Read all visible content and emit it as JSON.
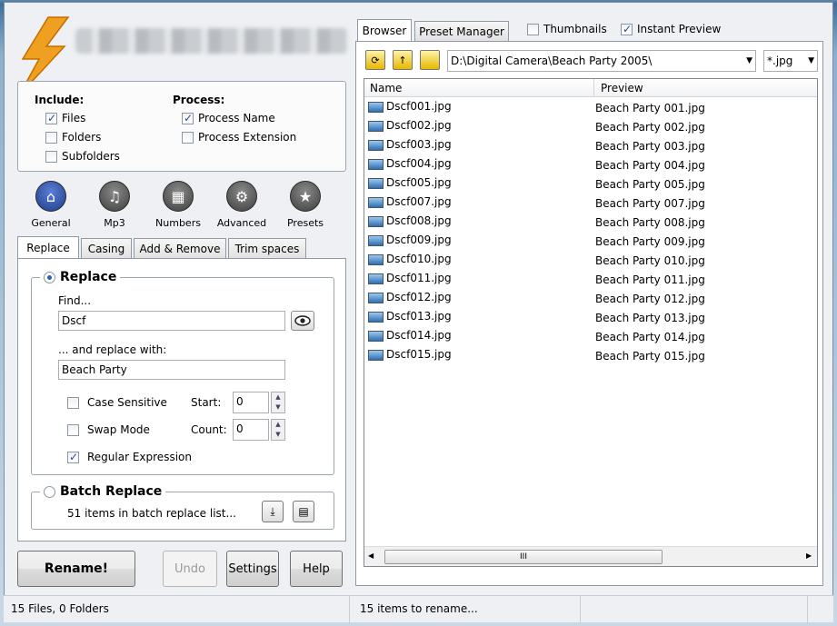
{
  "include": {
    "label": "Include:",
    "files": "Files",
    "folders": "Folders",
    "subfolders": "Subfolders"
  },
  "process": {
    "label": "Process:",
    "name": "Process Name",
    "extension": "Process Extension"
  },
  "modes": [
    {
      "label": "General"
    },
    {
      "label": "Mp3"
    },
    {
      "label": "Numbers"
    },
    {
      "label": "Advanced"
    },
    {
      "label": "Presets"
    }
  ],
  "subtabs": [
    "Replace",
    "Casing",
    "Add & Remove",
    "Trim spaces"
  ],
  "replace": {
    "title": "Replace",
    "find_label": "Find...",
    "find_value": "Dscf",
    "replace_label": "... and replace with:",
    "replace_value": "Beach Party",
    "case_sensitive": "Case Sensitive",
    "start_label": "Start:",
    "start_value": "0",
    "swap_mode": "Swap Mode",
    "count_label": "Count:",
    "count_value": "0",
    "regex": "Regular Expression"
  },
  "batch": {
    "title": "Batch Replace",
    "info": "51 items in batch replace list..."
  },
  "buttons": {
    "rename": "Rename!",
    "undo": "Undo",
    "settings": "Settings",
    "help": "Help"
  },
  "right_tabs": {
    "browser": "Browser",
    "preset_manager": "Preset Manager",
    "thumbnails": "Thumbnails",
    "instant_preview": "Instant Preview"
  },
  "path": "D:\\Digital Camera\\Beach Party 2005\\",
  "filter": "*.jpg",
  "columns": {
    "name": "Name",
    "preview": "Preview"
  },
  "files": [
    {
      "name": "Dscf001.jpg",
      "preview": "Beach Party 001.jpg"
    },
    {
      "name": "Dscf002.jpg",
      "preview": "Beach Party 002.jpg"
    },
    {
      "name": "Dscf003.jpg",
      "preview": "Beach Party 003.jpg"
    },
    {
      "name": "Dscf004.jpg",
      "preview": "Beach Party 004.jpg"
    },
    {
      "name": "Dscf005.jpg",
      "preview": "Beach Party 005.jpg"
    },
    {
      "name": "Dscf007.jpg",
      "preview": "Beach Party 007.jpg"
    },
    {
      "name": "Dscf008.jpg",
      "preview": "Beach Party 008.jpg"
    },
    {
      "name": "Dscf009.jpg",
      "preview": "Beach Party 009.jpg"
    },
    {
      "name": "Dscf010.jpg",
      "preview": "Beach Party 010.jpg"
    },
    {
      "name": "Dscf011.jpg",
      "preview": "Beach Party 011.jpg"
    },
    {
      "name": "Dscf012.jpg",
      "preview": "Beach Party 012.jpg"
    },
    {
      "name": "Dscf013.jpg",
      "preview": "Beach Party 013.jpg"
    },
    {
      "name": "Dscf014.jpg",
      "preview": "Beach Party 014.jpg"
    },
    {
      "name": "Dscf015.jpg",
      "preview": "Beach Party 015.jpg"
    }
  ],
  "scroll_grip": "III",
  "status": {
    "left": "15 Files, 0 Folders",
    "right": "15 items to rename..."
  },
  "colors": {
    "accent": "#2a61b8",
    "logo": "#f0a020"
  }
}
